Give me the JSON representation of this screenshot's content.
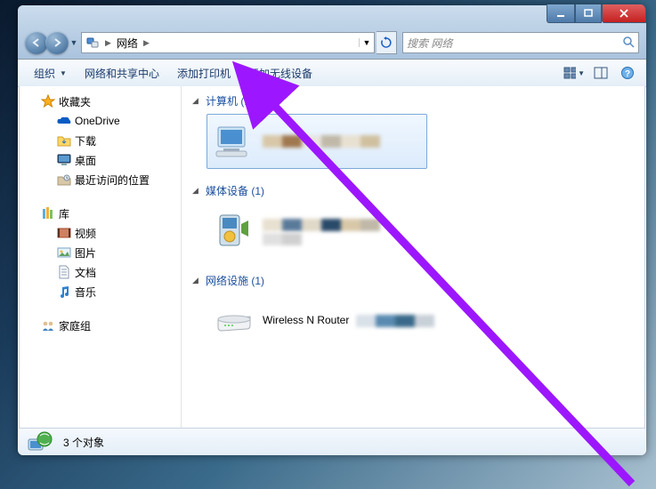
{
  "address_bar": {
    "root": "网络",
    "dropdown_icon": "▼",
    "refresh_icon": "↻"
  },
  "search": {
    "placeholder": "搜索 网络"
  },
  "toolbar": {
    "organize": "组织",
    "network_center": "网络和共享中心",
    "add_printer": "添加打印机",
    "add_wireless": "添加无线设备"
  },
  "sidebar": {
    "favorites_header": "收藏夹",
    "favorites": [
      {
        "label": "OneDrive",
        "icon": "onedrive"
      },
      {
        "label": "下载",
        "icon": "downloads"
      },
      {
        "label": "桌面",
        "icon": "desktop"
      },
      {
        "label": "最近访问的位置",
        "icon": "recent"
      }
    ],
    "libraries_header": "库",
    "libraries": [
      {
        "label": "视频",
        "icon": "videos"
      },
      {
        "label": "图片",
        "icon": "pictures"
      },
      {
        "label": "文档",
        "icon": "documents"
      },
      {
        "label": "音乐",
        "icon": "music"
      }
    ],
    "homegroup_header": "家庭组"
  },
  "groups": {
    "computers": {
      "title": "计算机 (1)"
    },
    "media_devices": {
      "title": "媒体设备 (1)"
    },
    "network_equipment": {
      "title": "网络设施 (1)",
      "item_name": "Wireless N Router"
    }
  },
  "status": {
    "text": "3 个对象"
  },
  "colors": {
    "group_title": "#1a4e9c",
    "toolbar_text": "#1a3a6a",
    "selection_border": "#7da9d9",
    "annotation_arrow": "#9c17ff"
  }
}
